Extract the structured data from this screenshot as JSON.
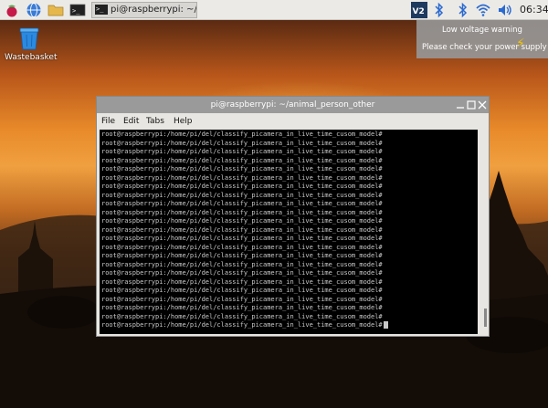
{
  "taskbar": {
    "apps": [
      {
        "name": "raspberry-menu-icon"
      },
      {
        "name": "web-browser-icon"
      },
      {
        "name": "file-manager-icon"
      },
      {
        "name": "terminal-icon"
      }
    ],
    "task_label": "pi@raspberrypi: ~/ani...",
    "tray": [
      "vnc-icon",
      "bluetooth-icon",
      "bluetooth-icon",
      "wifi-icon",
      "volume-icon"
    ],
    "clock": "06:34"
  },
  "notification": {
    "title": "Low voltage warning",
    "message": "Please check your power supply"
  },
  "desktop": {
    "icons": [
      {
        "label": "Wastebasket"
      }
    ]
  },
  "terminal": {
    "title": "pi@raspberrypi: ~/animal_person_other",
    "menu": [
      "File",
      "Edit",
      "Tabs",
      "Help"
    ],
    "lines": [
      "root@raspberrypi:/home/pi/del/classify_picamera_in_live_time_cusom_model#",
      "root@raspberrypi:/home/pi/del/classify_picamera_in_live_time_cusom_model#",
      "root@raspberrypi:/home/pi/del/classify_picamera_in_live_time_cusom_model#",
      "root@raspberrypi:/home/pi/del/classify_picamera_in_live_time_cusom_model#",
      "root@raspberrypi:/home/pi/del/classify_picamera_in_live_time_cusom_model#",
      "root@raspberrypi:/home/pi/del/classify_picamera_in_live_time_cusom_model#",
      "root@raspberrypi:/home/pi/del/classify_picamera_in_live_time_cusom_model#",
      "root@raspberrypi:/home/pi/del/classify_picamera_in_live_time_cusom_model#",
      "root@raspberrypi:/home/pi/del/classify_picamera_in_live_time_cusom_model#",
      "root@raspberrypi:/home/pi/del/classify_picamera_in_live_time_cusom_model#",
      "root@raspberrypi:/home/pi/del/classify_picamera_in_live_time_cusom_model#",
      "root@raspberrypi:/home/pi/del/classify_picamera_in_live_time_cusom_model#",
      "root@raspberrypi:/home/pi/del/classify_picamera_in_live_time_cusom_model#",
      "root@raspberrypi:/home/pi/del/classify_picamera_in_live_time_cusom_model#",
      "root@raspberrypi:/home/pi/del/classify_picamera_in_live_time_cusom_model#",
      "root@raspberrypi:/home/pi/del/classify_picamera_in_live_time_cusom_model#",
      "root@raspberrypi:/home/pi/del/classify_picamera_in_live_time_cusom_model#",
      "root@raspberrypi:/home/pi/del/classify_picamera_in_live_time_cusom_model#",
      "root@raspberrypi:/home/pi/del/classify_picamera_in_live_time_cusom_model#",
      "root@raspberrypi:/home/pi/del/classify_picamera_in_live_time_cusom_model#",
      "root@raspberrypi:/home/pi/del/classify_picamera_in_live_time_cusom_model#",
      "root@raspberrypi:/home/pi/del/classify_picamera_in_live_time_cusom_model#",
      "root@raspberrypi:/home/pi/del/classify_picamera_in_live_time_cusom_model#"
    ]
  }
}
